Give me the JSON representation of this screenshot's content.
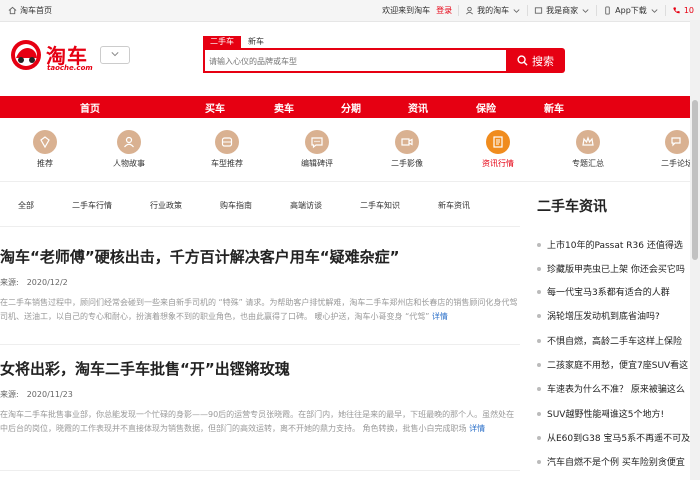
{
  "topbar": {
    "home_label": "淘车首页",
    "welcome": "欢迎来到淘车",
    "login": "登录",
    "my_taoche": "我的淘车",
    "merchant": "我是商家",
    "app_download": "App下载",
    "phone_prefix": "10"
  },
  "header": {
    "logo_text": "淘车",
    "logo_sub": "taoche.com",
    "search_tabs": [
      "二手车",
      "新车"
    ],
    "search_placeholder": "请输入心仪的品牌或车型",
    "search_button": "搜索"
  },
  "mainnav": [
    "首页",
    "买车",
    "卖车",
    "分期",
    "资讯",
    "保险",
    "新车"
  ],
  "categories": [
    {
      "label": "推荐",
      "icon": "diamond-icon",
      "active": false
    },
    {
      "label": "人物故事",
      "icon": "person-icon",
      "active": false
    },
    {
      "label": "车型推荐",
      "icon": "car-icon",
      "active": false
    },
    {
      "label": "编辑碑评",
      "icon": "chat-icon",
      "active": false
    },
    {
      "label": "二手影像",
      "icon": "camera-icon",
      "active": false
    },
    {
      "label": "资讯行情",
      "icon": "document-icon",
      "active": true
    },
    {
      "label": "专题汇总",
      "icon": "crown-icon",
      "active": false
    },
    {
      "label": "二手论坛",
      "icon": "forum-icon",
      "active": false
    }
  ],
  "subtabs": [
    "全部",
    "二手车行情",
    "行业政策",
    "购车指南",
    "高端访谈",
    "二手车知识",
    "新车资讯"
  ],
  "articles": [
    {
      "title": "淘车“老师傅”硬核出击，千方百计解决客户用车“疑难杂症”",
      "source_label": "来源:",
      "date": "2020/12/2",
      "summary": "在二手车销售过程中，顾问们经常会碰到一些来自新手司机的 “特殊” 请求。为帮助客户排忧解难，淘车二手车郑州店和长春店的销售顾问化身代驾司机、送油工，以自己的专心和耐心，扮演着想象不到的职业角色，也由此赢得了口碑。 暖心护送，淘车小哥变身 “代驾”",
      "more": "详情"
    },
    {
      "title": "女将出彩，淘车二手车批售“开”出铿锵玫瑰",
      "source_label": "来源:",
      "date": "2020/11/23",
      "summary": "在淘车二手车批售事业部，你总能发现一个忙碌的身影——90后的运营专员张晓霞。在部门内，她往往是来的最早，下班最晚的那个人。虽然处在中后台的岗位，晓霞的工作表现并不直接体现为销售数据，但部门的高效运转，离不开她的鼎力支持。 角色转换，批售小白完成职场",
      "more": "详情"
    }
  ],
  "sidebar": {
    "title": "二手车资讯",
    "items": [
      "上市10年的Passat R36 还值得选",
      "珍藏版甲壳虫已上架 你还会买它吗",
      "每一代宝马3系都有适合的人群",
      "涡轮增压发动机到底省油吗?",
      "不惧自燃，高龄二手车这样上保险",
      "二孩家庭不用愁，便宜7座SUV看这",
      "车速表为什么不准？ 原来被骗这么",
      "SUV越野性能째谁这5个地方!",
      "从E60到G38 宝马5系不再遥不可及",
      "汽车自燃不是个例 买车险别贪便宜"
    ]
  }
}
